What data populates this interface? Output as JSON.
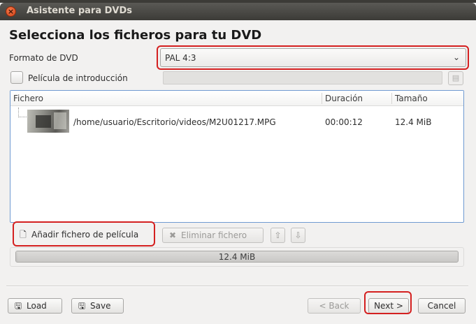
{
  "window": {
    "title": "Asistente para DVDs"
  },
  "heading": "Selecciona los ficheros para tu DVD",
  "format": {
    "label": "Formato de DVD",
    "value": "PAL 4:3"
  },
  "intro": {
    "label": "Película de introducción",
    "checked": false
  },
  "filelist": {
    "columns": [
      "Fichero",
      "Duración",
      "Tamaño"
    ],
    "rows": [
      {
        "file": "/home/usuario/Escritorio/videos/M2U01217.MPG",
        "duration": "00:00:12",
        "size": "12.4 MiB"
      }
    ]
  },
  "actions": {
    "add_file": "Añadir fichero de película",
    "remove_file": "Eliminar fichero",
    "move_up_icon": "arrow-up-icon",
    "move_down_icon": "arrow-down-icon"
  },
  "usage": {
    "text": "12.4 MiB",
    "fraction": 0.003
  },
  "footer": {
    "load": "Load",
    "save": "Save",
    "back": "< Back",
    "next": "Next >",
    "cancel": "Cancel"
  },
  "colors": {
    "highlight_ring": "#d42020",
    "selection_border": "#6f9ad1"
  }
}
